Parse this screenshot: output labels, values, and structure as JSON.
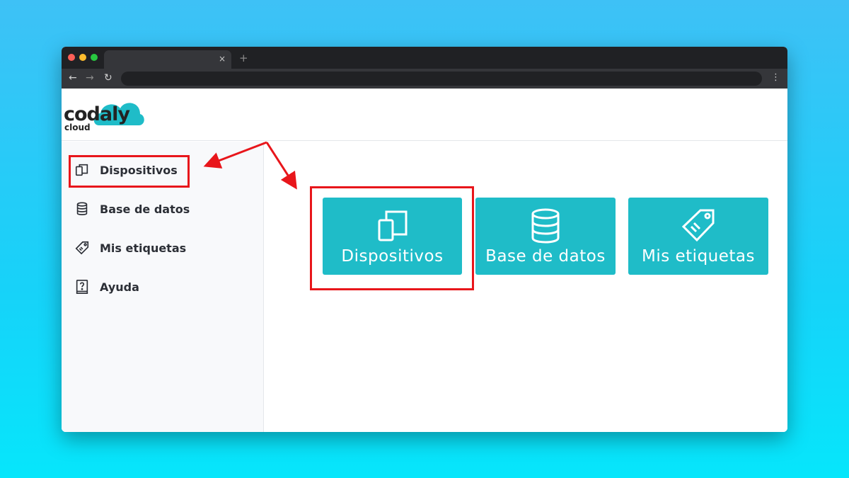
{
  "browser": {
    "tab_close": "×",
    "new_tab": "+",
    "back": "←",
    "forward": "→",
    "reload": "↻",
    "menu": "⋮"
  },
  "logo": {
    "name": "codaly",
    "sub": "cloud",
    "accent": "#1fbcc8"
  },
  "sidebar": {
    "items": [
      {
        "label": "Dispositivos",
        "icon": "devices-icon"
      },
      {
        "label": "Base de datos",
        "icon": "database-icon"
      },
      {
        "label": "Mis etiquetas",
        "icon": "tag-icon"
      },
      {
        "label": "Ayuda",
        "icon": "help-book-icon"
      }
    ]
  },
  "cards": [
    {
      "label": "Dispositivos",
      "icon": "devices-icon"
    },
    {
      "label": "Base de datos",
      "icon": "database-icon"
    },
    {
      "label": "Mis etiquetas",
      "icon": "tag-icon"
    }
  ],
  "colors": {
    "card": "#1fbcc8",
    "highlight": "#e8161b"
  }
}
